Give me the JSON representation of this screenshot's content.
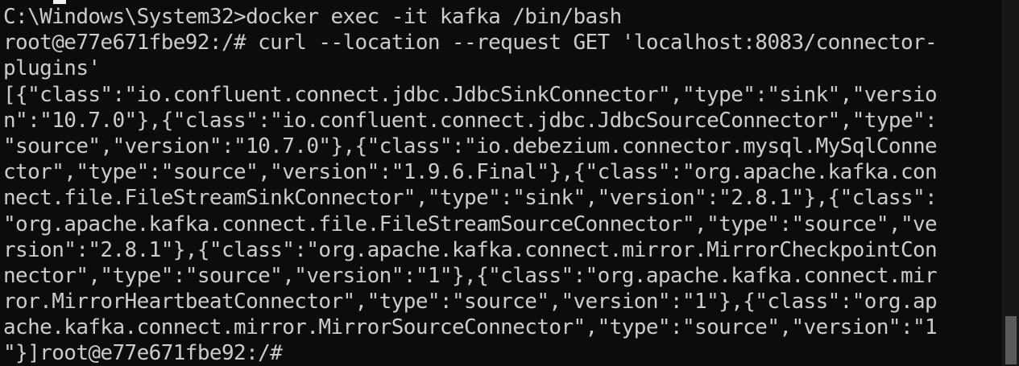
{
  "terminal": {
    "colors": {
      "background": "#0c0c0c",
      "foreground": "#cccccc",
      "cursor": "#f2f2f2",
      "scrollbar_track": "#171717",
      "scrollbar_thumb": "#5a5a5a"
    },
    "lines": [
      "C:\\Windows\\System32>docker exec -it kafka /bin/bash",
      "root@e77e671fbe92:/# curl --location --request GET 'localhost:8083/connector-",
      "plugins'",
      "[{\"class\":\"io.confluent.connect.jdbc.JdbcSinkConnector\",\"type\":\"sink\",\"versio",
      "n\":\"10.7.0\"},{\"class\":\"io.confluent.connect.jdbc.JdbcSourceConnector\",\"type\":",
      "\"source\",\"version\":\"10.7.0\"},{\"class\":\"io.debezium.connector.mysql.MySqlConne",
      "ctor\",\"type\":\"source\",\"version\":\"1.9.6.Final\"},{\"class\":\"org.apache.kafka.con",
      "nect.file.FileStreamSinkConnector\",\"type\":\"sink\",\"version\":\"2.8.1\"},{\"class\":",
      "\"org.apache.kafka.connect.file.FileStreamSourceConnector\",\"type\":\"source\",\"ve",
      "rsion\":\"2.8.1\"},{\"class\":\"org.apache.kafka.connect.mirror.MirrorCheckpointCon",
      "nector\",\"type\":\"source\",\"version\":\"1\"},{\"class\":\"org.apache.kafka.connect.mir",
      "ror.MirrorHeartbeatConnector\",\"type\":\"source\",\"version\":\"1\"},{\"class\":\"org.ap",
      "ache.kafka.connect.mirror.MirrorSourceConnector\",\"type\":\"source\",\"version\":\"1",
      "\"}]root@e77e671fbe92:/#"
    ]
  }
}
